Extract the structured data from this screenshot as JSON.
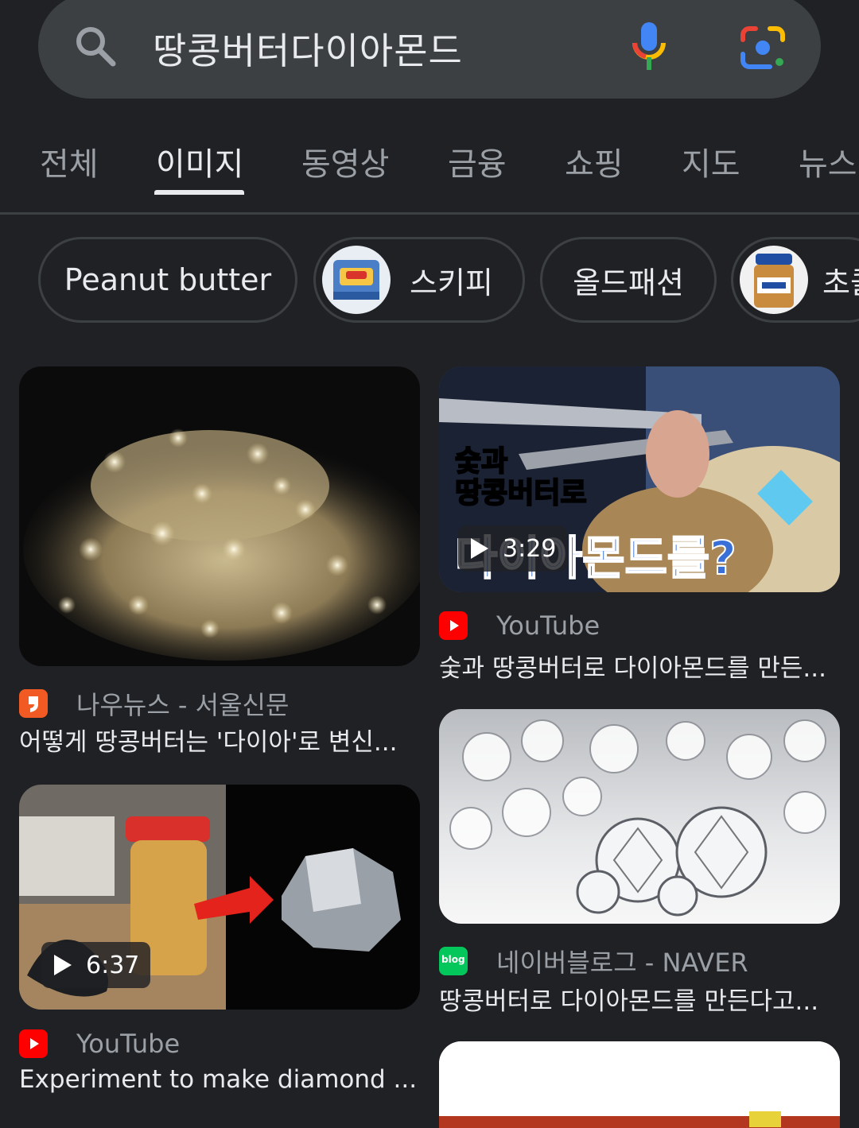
{
  "search": {
    "query": "땅콩버터다이아몬드"
  },
  "tabs": [
    {
      "label": "전체"
    },
    {
      "label": "이미지"
    },
    {
      "label": "동영상"
    },
    {
      "label": "금융"
    },
    {
      "label": "쇼핑"
    },
    {
      "label": "지도"
    },
    {
      "label": "뉴스"
    }
  ],
  "active_tab": "이미지",
  "chips": [
    {
      "label": "Peanut butter"
    },
    {
      "label": "스키피"
    },
    {
      "label": "올드패션"
    },
    {
      "label": "초콜"
    }
  ],
  "results": [
    {
      "source": "나우뉴스 - 서울신문",
      "title": "어떻게 땅콩버터는 '다이아'로 변신...",
      "source_icon": "nownews-icon"
    },
    {
      "source": "YouTube",
      "title": "숯과 땅콩버터로 다이아몬드를 만든...",
      "source_icon": "youtube-icon",
      "duration": "3:29",
      "thumb_text": {
        "line1": "숯과",
        "line2": "땅콩버터로",
        "line3": "다이아몬드를?"
      }
    },
    {
      "source": "YouTube",
      "title": "Experiment to make diamond ...",
      "source_icon": "youtube-icon",
      "duration": "6:37"
    },
    {
      "source": "네이버블로그 - NAVER",
      "title": "땅콩버터로 다이아몬드를 만든다고...",
      "source_icon": "naver-blog-icon",
      "icon_text": "blog"
    }
  ],
  "colors": {
    "background": "#202124",
    "searchbar": "#3c4043",
    "youtube_red": "#ff0000",
    "naver_green": "#03c75a",
    "nownews_orange": "#f15a22"
  }
}
